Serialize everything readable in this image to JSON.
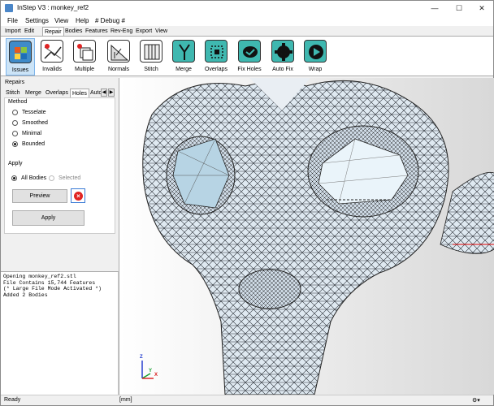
{
  "window": {
    "title": "InStep V3 : monkey_ref2",
    "min": "—",
    "max": "☐",
    "close": "✕"
  },
  "menu": [
    "File",
    "Settings",
    "View",
    "Help",
    "# Debug #"
  ],
  "ribbon_tabs": [
    "Import",
    "Edit",
    "Repair",
    "Bodies",
    "Features",
    "Rev-Eng",
    "Export",
    "View"
  ],
  "ribbon_active": "Repair",
  "ribbon_buttons": [
    {
      "label": "Issues",
      "icon": "issues-icon",
      "color": "#3f8bc9"
    },
    {
      "label": "Invalids",
      "icon": "invalids-icon",
      "color": "#ffffff"
    },
    {
      "label": "Multiple",
      "icon": "multiple-icon",
      "color": "#ffffff"
    },
    {
      "label": "Normals",
      "icon": "normals-icon",
      "color": "#ffffff"
    },
    {
      "label": "Stitch",
      "icon": "stitch-icon",
      "color": "#ffffff"
    },
    {
      "label": "Merge",
      "icon": "merge-icon",
      "color": "#3fb8b0"
    },
    {
      "label": "Overlaps",
      "icon": "overlaps-icon",
      "color": "#3fb8b0"
    },
    {
      "label": "Fix Holes",
      "icon": "fix-holes-icon",
      "color": "#3fb8b0"
    },
    {
      "label": "Auto Fix",
      "icon": "auto-fix-icon",
      "color": "#3fb8b0"
    },
    {
      "label": "Wrap",
      "icon": "wrap-icon",
      "color": "#3fb8b0"
    }
  ],
  "left_panel": {
    "title": "Repairs",
    "tabs": [
      "Stitch",
      "Merge",
      "Overlaps",
      "Holes",
      "Auto"
    ],
    "active_tab": "Holes",
    "method_title": "Method",
    "methods": [
      {
        "label": "Tesselate",
        "checked": false
      },
      {
        "label": "Smoothed",
        "checked": false
      },
      {
        "label": "Minimal",
        "checked": false
      },
      {
        "label": "Bounded",
        "checked": true
      }
    ],
    "apply_title": "Apply",
    "scope": [
      {
        "label": "All Bodies",
        "checked": true
      },
      {
        "label": "Selected",
        "checked": false
      }
    ],
    "preview_label": "Preview",
    "apply_label": "Apply"
  },
  "log": [
    "Opening monkey_ref2.stl",
    "File Contains 15,744 Features",
    "(* Large File Mode Activated *)",
    "Added 2 Bodies"
  ],
  "axes": {
    "z": "Z",
    "y": "Y",
    "x": "X"
  },
  "status": {
    "state": "Ready",
    "units": "[mm]"
  }
}
